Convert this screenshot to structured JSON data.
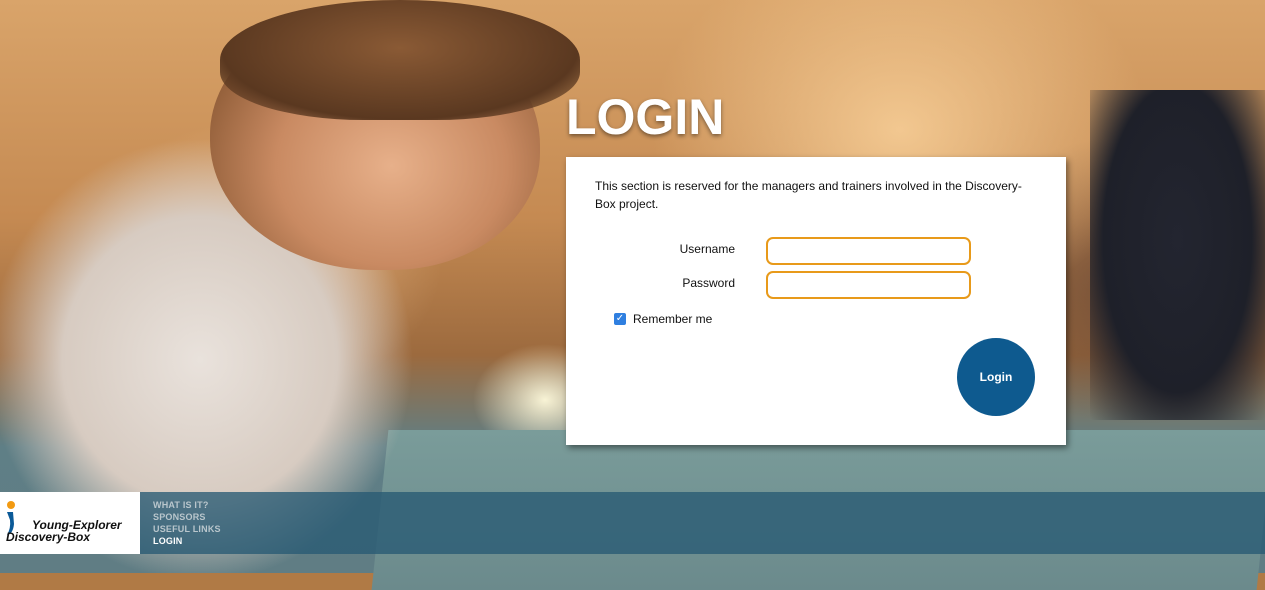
{
  "page": {
    "title": "LOGIN"
  },
  "login_panel": {
    "intro": "This section is reserved for the managers and trainers involved in the Discovery-Box project.",
    "username_label": "Username",
    "username_value": "",
    "password_label": "Password",
    "password_value": "",
    "remember_label": "Remember me",
    "remember_checked": true,
    "submit_label": "Login"
  },
  "logo": {
    "line1": "Young-Explorer",
    "line2": "Discovery-Box"
  },
  "nav": {
    "items": [
      {
        "label": "WHAT IS IT?",
        "active": false
      },
      {
        "label": "SPONSORS",
        "active": false
      },
      {
        "label": "USEFUL LINKS",
        "active": false
      },
      {
        "label": "LOGIN",
        "active": true
      }
    ]
  },
  "colors": {
    "accent_button": "#0e5a8f",
    "field_border": "#e89a1a",
    "checkbox": "#2f7fe0",
    "footer_bar": "#285a73"
  },
  "icons": {
    "checkbox": "checkmark-icon",
    "logo": "discovery-box-logo-icon"
  }
}
